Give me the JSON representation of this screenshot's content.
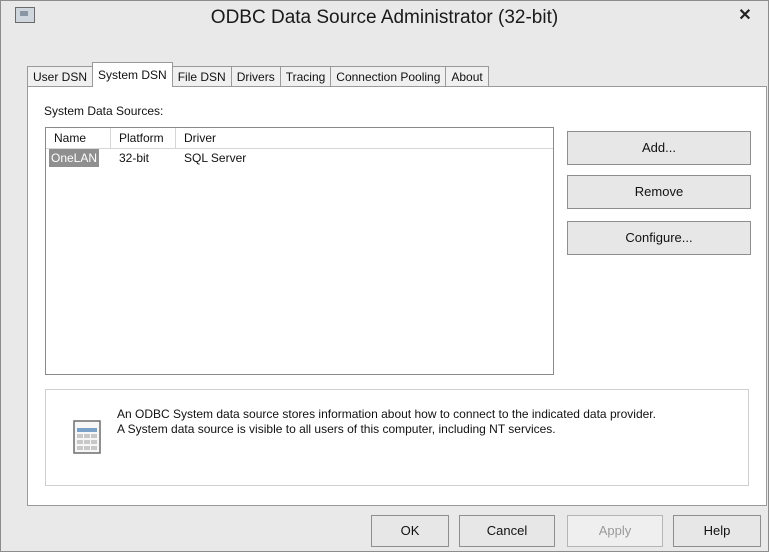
{
  "window": {
    "title": "ODBC Data Source Administrator (32-bit)",
    "close_glyph": "✕"
  },
  "tabs": [
    {
      "label": "User DSN",
      "active": false
    },
    {
      "label": "System DSN",
      "active": true
    },
    {
      "label": "File DSN",
      "active": false
    },
    {
      "label": "Drivers",
      "active": false
    },
    {
      "label": "Tracing",
      "active": false
    },
    {
      "label": "Connection Pooling",
      "active": false
    },
    {
      "label": "About",
      "active": false
    }
  ],
  "system_dsn": {
    "section_label": "System Data Sources:",
    "columns": [
      "Name",
      "Platform",
      "Driver"
    ],
    "rows": [
      {
        "name": "OneLAN",
        "platform": "32-bit",
        "driver": "SQL Server",
        "selected": true
      }
    ],
    "buttons": {
      "add": "Add...",
      "remove": "Remove",
      "configure": "Configure..."
    },
    "info_text_1": "An ODBC System data source stores information about how to connect to the indicated data provider.",
    "info_text_2": "A System data source is visible to all users of this computer, including NT services."
  },
  "footer": {
    "ok": "OK",
    "cancel": "Cancel",
    "apply": "Apply",
    "help": "Help"
  },
  "icons": {
    "app": "odbc-window-icon",
    "info": "data-source-document-icon",
    "close": "close-icon"
  }
}
